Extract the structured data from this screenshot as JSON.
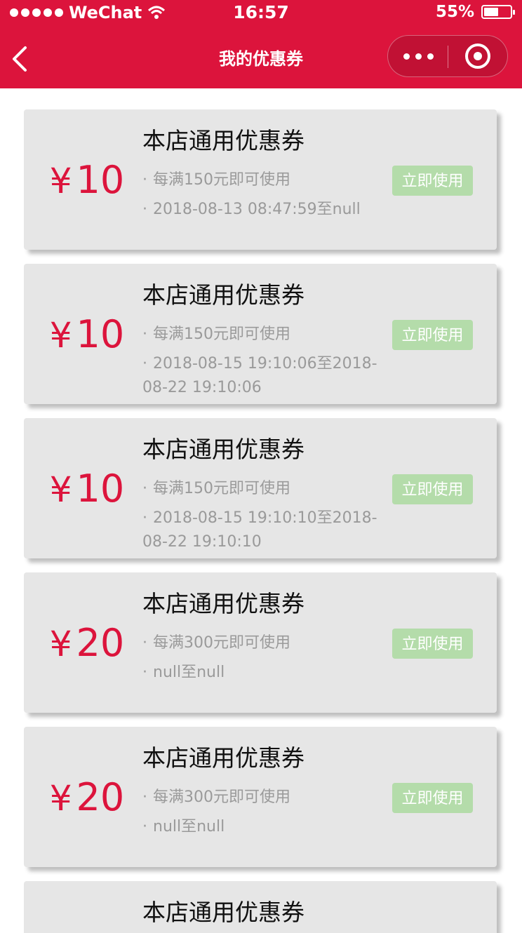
{
  "status_bar": {
    "carrier": "WeChat",
    "time": "16:57",
    "battery": "55%",
    "battery_level": 0.55
  },
  "nav": {
    "title": "我的优惠券"
  },
  "coupons": [
    {
      "currency": "¥",
      "amount": "10",
      "title": "本店通用优惠券",
      "condition": "每满150元即可使用",
      "dates": "2018-08-13 08:47:59至null",
      "button": "立即使用"
    },
    {
      "currency": "¥",
      "amount": "10",
      "title": "本店通用优惠券",
      "condition": "每满150元即可使用",
      "dates": "2018-08-15 19:10:06至2018-08-22 19:10:06",
      "button": "立即使用"
    },
    {
      "currency": "¥",
      "amount": "10",
      "title": "本店通用优惠券",
      "condition": "每满150元即可使用",
      "dates": "2018-08-15 19:10:10至2018-08-22 19:10:10",
      "button": "立即使用"
    },
    {
      "currency": "¥",
      "amount": "20",
      "title": "本店通用优惠券",
      "condition": "每满300元即可使用",
      "dates": "null至null",
      "button": "立即使用"
    },
    {
      "currency": "¥",
      "amount": "20",
      "title": "本店通用优惠券",
      "condition": "每满300元即可使用",
      "dates": "null至null",
      "button": "立即使用"
    },
    {
      "title": "本店通用优惠券"
    }
  ]
}
